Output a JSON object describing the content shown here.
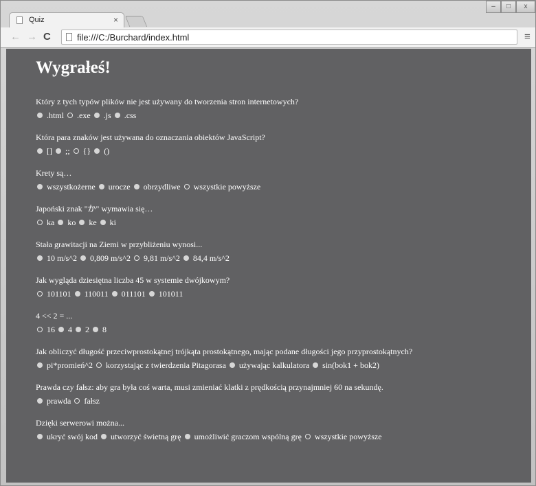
{
  "browser": {
    "tab_title": "Quiz",
    "tab_close": "×",
    "url": "file:///C:/Burchard/index.html",
    "window_controls": {
      "minimize": "–",
      "maximize": "□",
      "close": "x"
    },
    "nav": {
      "back": "←",
      "forward": "→",
      "reload": "C",
      "menu": "≡"
    }
  },
  "page": {
    "heading": "Wygrałeś!",
    "questions": [
      {
        "text": "Który z tych typów plików nie jest używany do tworzenia stron internetowych?",
        "options": [
          ".html",
          ".exe",
          ".js",
          ".css"
        ],
        "selected": 1
      },
      {
        "text": "Która para znaków jest używana do oznaczania obiektów JavaScript?",
        "options": [
          "[]",
          ";;",
          "{}",
          "()"
        ],
        "selected": 2
      },
      {
        "text": "Krety są…",
        "options": [
          "wszystkożerne",
          "urocze",
          "obrzydliwe",
          "wszystkie powyższe"
        ],
        "selected": 3
      },
      {
        "text": "Japoński znak \"か\" wymawia się…",
        "options": [
          "ka",
          "ko",
          "ke",
          "ki"
        ],
        "selected": 0
      },
      {
        "text": "Stała grawitacji na Ziemi w przybliżeniu wynosi...",
        "options": [
          "10 m/s^2",
          "0,809 m/s^2",
          "9,81 m/s^2",
          "84,4 m/s^2"
        ],
        "selected": 2
      },
      {
        "text": "Jak wygląda dziesiętna liczba 45 w systemie dwójkowym?",
        "options": [
          "101101",
          "110011",
          "011101",
          "101011"
        ],
        "selected": 0
      },
      {
        "text": "4 << 2 = ...",
        "options": [
          "16",
          "4",
          "2",
          "8"
        ],
        "selected": 0
      },
      {
        "text": "Jak obliczyć długość przeciwprostokątnej trójkąta prostokątnego, mając podane długości jego przyprostokątnych?",
        "options": [
          "pi*promień^2",
          "korzystając z twierdzenia Pitagorasa",
          "używając kalkulatora",
          "sin(bok1 + bok2)"
        ],
        "selected": 1
      },
      {
        "text": "Prawda czy fałsz: aby gra była coś warta, musi zmieniać klatki z prędkością przynajmniej 60 na sekundę.",
        "options": [
          "prawda",
          "fałsz"
        ],
        "selected": 1
      },
      {
        "text": "Dzięki serwerowi można...",
        "options": [
          "ukryć swój kod",
          "utworzyć świetną grę",
          "umożliwić graczom wspólną grę",
          "wszystkie powyższe"
        ],
        "selected": 3
      }
    ]
  },
  "colors": {
    "page_bg": "#616163",
    "text": "#ffffff",
    "radio_fill": "#d6d6d6"
  }
}
